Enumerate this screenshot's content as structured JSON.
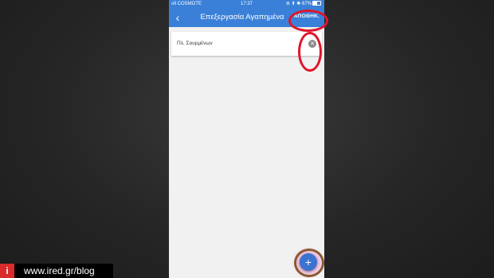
{
  "status_bar": {
    "carrier": "ııll COSMOTE",
    "time": "17:37",
    "right": "⊚ ⬆ ✱ 67%"
  },
  "app_bar": {
    "back_icon": "back-chevron-icon",
    "title": "Επεξεργασία Αγαπημένα",
    "save_label": "ΑΠΟΘΗΚ."
  },
  "favorites": [
    {
      "label": "Πλ. Σουρμένων",
      "clear_icon": "clear-circle-icon"
    }
  ],
  "fab": {
    "icon": "plus-icon",
    "symbol": "+"
  },
  "watermark": {
    "logo_letter": "i",
    "text": "www.ired.gr/blog"
  },
  "colors": {
    "app_bar": "#3a80d9",
    "annotation_red": "#e0152a",
    "annotation_brown": "#8a5a2f",
    "fab": "#3a73d0",
    "fab_glow": "#e23caa"
  }
}
